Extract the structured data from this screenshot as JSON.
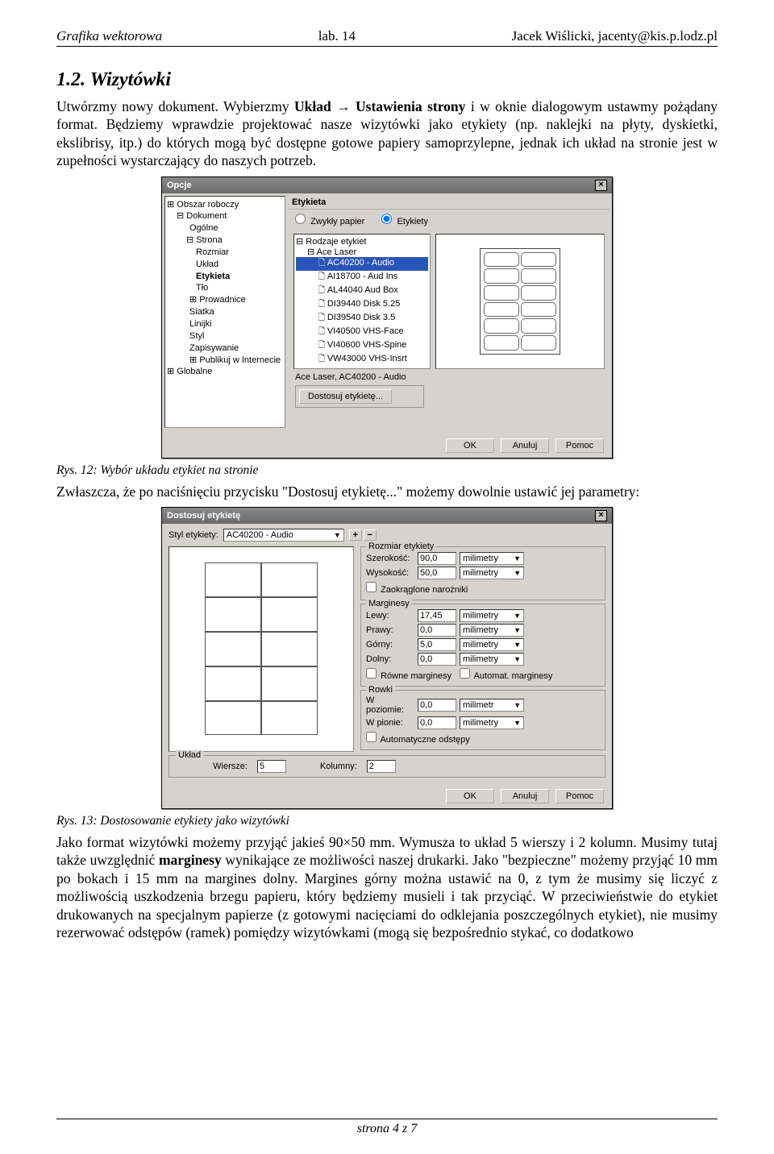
{
  "header": {
    "left": "Grafika wektorowa",
    "center": "lab. 14",
    "right": "Jacek Wiślicki, jacenty@kis.p.lodz.pl"
  },
  "section": {
    "title": "1.2. Wizytówki"
  },
  "para1a": "Utwórzmy nowy dokument. Wybierzmy ",
  "para1b": "Układ → Ustawienia strony",
  "para1c": " i w oknie dialogowym ustawmy pożądany format. Będziemy wprawdzie projektować nasze wizytówki jako etykiety (np. naklejki na płyty, dyskietki, ekslibrisy, itp.) do których mogą być dostępne gotowe papiery samoprzylepne, jednak ich układ na stronie jest w zupełności wystarczający do naszych potrzeb.",
  "dialog1": {
    "title": "Opcje",
    "tree": [
      "Obszar roboczy",
      "Dokument",
      "Ogólne",
      "Strona",
      "Rozmiar",
      "Układ",
      "Etykieta",
      "Tło",
      "Prowadnice",
      "Siatka",
      "Linijki",
      "Styl",
      "Zapisywanie",
      "Publikuj w Internecie",
      "Globalne"
    ],
    "panel_title": "Etykieta",
    "radio1": "Zwykły papier",
    "radio2": "Etykiety",
    "label_types_root": "Rodzaje etykiet",
    "label_types_vendor": "Ace Laser",
    "label_items": [
      "AC40200 - Audio",
      "AI18700 - Aud Ins",
      "AL44040 Aud Box",
      "DI39440 Disk 5.25",
      "DI39540 Disk 3.5",
      "VI40500 VHS-Face",
      "VI40600 VHS-Spine",
      "VW43000 VHS-Insrt"
    ],
    "selected_label": "Ace Laser, AC40200 - Audio",
    "customize_btn": "Dostosuj etykietę...",
    "ok": "OK",
    "cancel": "Anuluj",
    "help": "Pomoc"
  },
  "caption1": "Rys. 12: Wybór układu etykiet na stronie",
  "para2": "Zwłaszcza, że po naciśnięciu przycisku \"Dostosuj etykietę...\" możemy dowolnie ustawić jej parametry:",
  "dialog2": {
    "title": "Dostosuj etykietę",
    "style_label": "Styl etykiety:",
    "style_value": "AC40200 - Audio",
    "size_legend": "Rozmiar etykiety",
    "width_lbl": "Szerokość:",
    "width_val": "90,0",
    "height_lbl": "Wysokość:",
    "height_val": "50,0",
    "unit": "milimetry",
    "rounded": "Zaokrąglone narożniki",
    "margins_legend": "Marginesy",
    "left_lbl": "Lewy:",
    "left_val": "17,45",
    "right_lbl": "Prawy:",
    "right_val": "0,0",
    "top_lbl": "Górny:",
    "top_val": "5,0",
    "bottom_lbl": "Dolny:",
    "bottom_val": "0,0",
    "eq_margins": "Równe marginesy",
    "auto_margins": "Automat. marginesy",
    "gutters_legend": "Rowki",
    "hgut_lbl": "W poziomie:",
    "hgut_val": "0,0",
    "vgut_lbl": "W pionie:",
    "vgut_val": "0,0",
    "unit_mm": "milimetr",
    "auto_spacing": "Automatyczne odstępy",
    "layout_legend": "Układ",
    "rows_lbl": "Wiersze:",
    "rows_val": "5",
    "cols_lbl": "Kolumny:",
    "cols_val": "2",
    "ok": "OK",
    "cancel": "Anuluj",
    "help": "Pomoc"
  },
  "caption2": "Rys. 13: Dostosowanie etykiety jako wizytówki",
  "para3a": "Jako format wizytówki możemy przyjąć jakieś 90×50 mm. Wymusza to układ 5 wierszy i 2 kolumn. Musimy tutaj także uwzględnić ",
  "para3b": "marginesy",
  "para3c": " wynikające ze możliwości naszej drukarki. Jako \"bezpieczne\" możemy przyjąć 10 mm po bokach i 15 mm na margines dolny. Margines górny można ustawić na 0, z tym że musimy się liczyć z możliwością uszkodzenia brzegu papieru, który będziemy musieli i tak przyciąć. W przeciwieństwie do etykiet drukowanych na specjalnym papierze (z gotowymi nacięciami do odklejania poszczególnych etykiet), nie musimy rezerwować odstępów (ramek) pomiędzy wizytówkami (mogą się bezpośrednio stykać, co dodatkowo",
  "footer": "strona 4 z 7"
}
